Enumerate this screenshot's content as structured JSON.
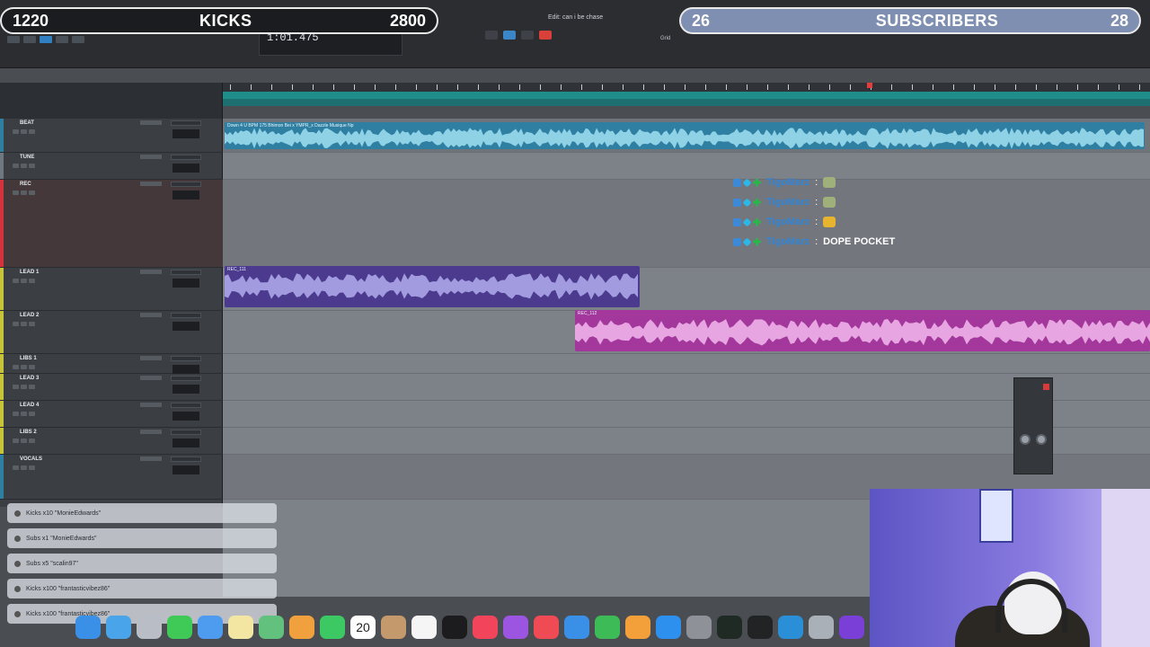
{
  "overlay": {
    "kicks_count_left": "1220",
    "kicks_label": "KICKS",
    "kicks_goal": "2800",
    "subs_count_left": "26",
    "subs_label": "SUBSCRIBERS",
    "subs_goal": "28"
  },
  "daw": {
    "counter": "1:01.475",
    "edit_window_title": "Edit: can i be chase",
    "grid_label": "Grid"
  },
  "tracks": [
    {
      "name": "BEAT",
      "color": "#2f7fa3"
    },
    {
      "name": "TUNE",
      "color": "#6f7880"
    },
    {
      "name": "REC",
      "color": "#d4323c"
    },
    {
      "name": "LEAD 1",
      "color": "#c6c33a"
    },
    {
      "name": "LEAD 2",
      "color": "#c6c33a"
    },
    {
      "name": "LIBS 1",
      "color": "#c6c33a"
    },
    {
      "name": "LEAD 3",
      "color": "#c6c33a"
    },
    {
      "name": "LEAD 4",
      "color": "#c6c33a"
    },
    {
      "name": "LIBS 2",
      "color": "#c6c33a"
    },
    {
      "name": "VOCALS",
      "color": "#2f7fa3"
    }
  ],
  "clips": {
    "beat": "Down 4 U BPM 175 Bhimon Bei x YMPR_x Dazzle Musique Np",
    "lead1": "REC_111",
    "lead2": "REC_112"
  },
  "chat": [
    {
      "user": "TigoMarz",
      "msg": "",
      "emote": "green"
    },
    {
      "user": "TigoMarz",
      "msg": "",
      "emote": "green"
    },
    {
      "user": "TigoMarz",
      "msg": "",
      "emote": "yellow"
    },
    {
      "user": "TigoMarz",
      "msg": "DOPE POCKET",
      "emote": ""
    }
  ],
  "alerts": [
    "Kicks x10 \"MonieEdwards\"",
    "Subs x1 \"MonieEdwards\"",
    "Subs x5 \"scalin97\"",
    "Kicks x100 \"frantasticvibez86\"",
    "Kicks x100 \"frantasticvibez86\""
  ],
  "calendar_day": "20"
}
